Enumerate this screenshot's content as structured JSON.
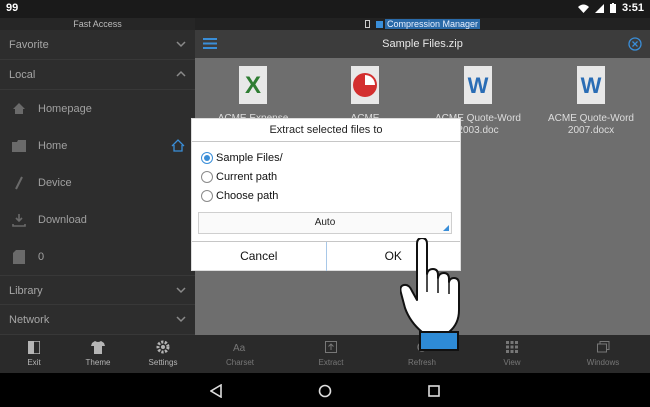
{
  "status_bar": {
    "left_text": "99",
    "time": "3:51"
  },
  "sidebar": {
    "title": "Fast Access",
    "sections": [
      {
        "label": "Favorite"
      },
      {
        "label": "Local"
      },
      {
        "label": "Library"
      },
      {
        "label": "Network"
      }
    ],
    "local_items": [
      {
        "label": "Homepage",
        "icon": "home-icon"
      },
      {
        "label": "Home",
        "icon": "folder-icon"
      },
      {
        "label": "Device",
        "icon": "slash-icon"
      },
      {
        "label": "Download",
        "icon": "download-icon"
      },
      {
        "label": "0",
        "icon": "sd-card-icon"
      }
    ]
  },
  "main": {
    "header_label": "Compression Manager",
    "title": "Sample Files.zip",
    "files": [
      {
        "name_line1": "ACME Expense",
        "name_line2": "",
        "icon": "excel-icon"
      },
      {
        "name_line1": "ACME",
        "name_line2": "",
        "icon": "chart-icon"
      },
      {
        "name_line1": "ACME Quote-Word",
        "name_line2": "2003.doc",
        "icon": "word-icon"
      },
      {
        "name_line1": "ACME Quote-Word",
        "name_line2": "2007.docx",
        "icon": "word-icon"
      }
    ]
  },
  "bottom_bar": {
    "items": [
      {
        "label": "Exit"
      },
      {
        "label": "Theme"
      },
      {
        "label": "Settings"
      },
      {
        "label": "Charset"
      },
      {
        "label": "Extract"
      },
      {
        "label": "Refresh"
      },
      {
        "label": "View"
      },
      {
        "label": "Windows"
      }
    ]
  },
  "dialog": {
    "title": "Extract selected files to",
    "options": [
      {
        "label": "Sample Files/",
        "selected": true
      },
      {
        "label": "Current path",
        "selected": false
      },
      {
        "label": "Choose path",
        "selected": false
      }
    ],
    "select_value": "Auto",
    "cancel_label": "Cancel",
    "ok_label": "OK"
  },
  "colors": {
    "accent": "#3a8ed8",
    "excel": "#2e7d32",
    "word": "#2a6db5",
    "chart": "#d32f2f"
  }
}
